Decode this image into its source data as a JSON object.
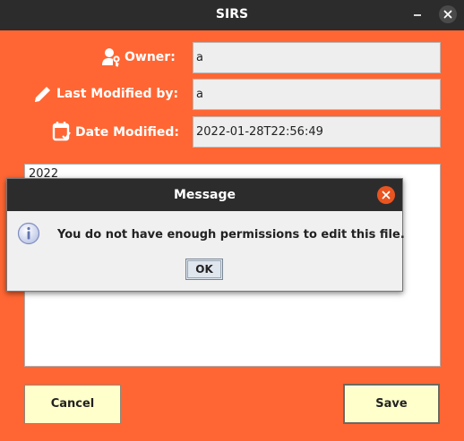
{
  "window": {
    "title": "SIRS"
  },
  "form": {
    "owner_label": "Owner:",
    "owner_value": "a",
    "last_modified_label": "Last Modified by:",
    "last_modified_value": "a",
    "date_modified_label": "Date Modified:",
    "date_modified_value": "2022-01-28T22:56:49",
    "content_text": "2022"
  },
  "buttons": {
    "cancel": "Cancel",
    "save": "Save"
  },
  "dialog": {
    "title": "Message",
    "message": "You do not have enough permissions to edit this file.",
    "ok_label": "OK"
  },
  "colors": {
    "background": "#ff6633",
    "titlebar": "#2c2c2c",
    "button": "#ffffcc",
    "dialog_close": "#e95420"
  },
  "icons": [
    "owner-icon",
    "pencil-icon",
    "calendar-icon",
    "info-icon",
    "close-icon",
    "minimize-icon"
  ]
}
